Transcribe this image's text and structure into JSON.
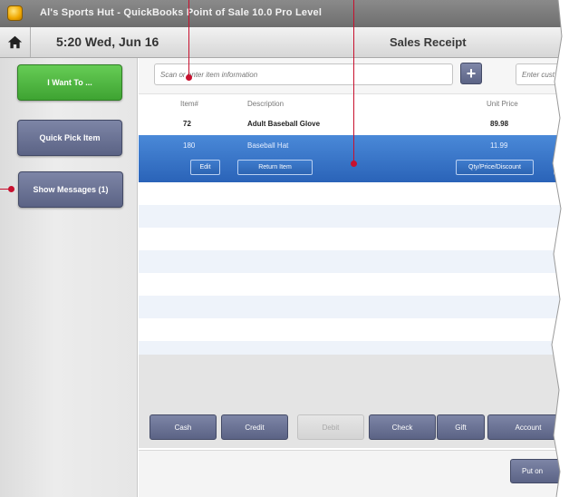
{
  "window": {
    "title": "Al's Sports Hut - QuickBooks Point of Sale 10.0 Pro Level"
  },
  "header": {
    "clock": "5:20 Wed, Jun 16",
    "screen_title": "Sales Receipt"
  },
  "sidebar": {
    "i_want_to": "I Want To ...",
    "quick_pick": "Quick Pick Item",
    "show_messages": "Show Messages (1)"
  },
  "search": {
    "item_placeholder": "Scan or enter item information",
    "add_symbol": "+",
    "customer_placeholder": "Enter cust"
  },
  "table": {
    "columns": [
      "Item#",
      "Description",
      "Unit Price"
    ],
    "rows": [
      {
        "item": "72",
        "description": "Adult Baseball Glove",
        "price": "89.98",
        "selected": false
      },
      {
        "item": "180",
        "description": "Baseball Hat",
        "price": "11.99",
        "selected": true
      }
    ],
    "row_actions": {
      "edit": "Edit",
      "return_item": "Return Item",
      "qty_price_discount": "Qty/Price/Discount"
    }
  },
  "payment": {
    "buttons": [
      {
        "label": "Cash",
        "enabled": true
      },
      {
        "label": "Credit",
        "enabled": true
      },
      {
        "label": "Debit",
        "enabled": false
      },
      {
        "label": "Check",
        "enabled": true
      },
      {
        "label": "Gift",
        "enabled": true
      },
      {
        "label": "Account",
        "enabled": true
      }
    ],
    "put_on_label": "Put on"
  },
  "colors": {
    "accent_green": "#3ea332",
    "slate_button": "#5b6385",
    "selection_blue": "#2a63b8",
    "callout_red": "#c8102e"
  }
}
